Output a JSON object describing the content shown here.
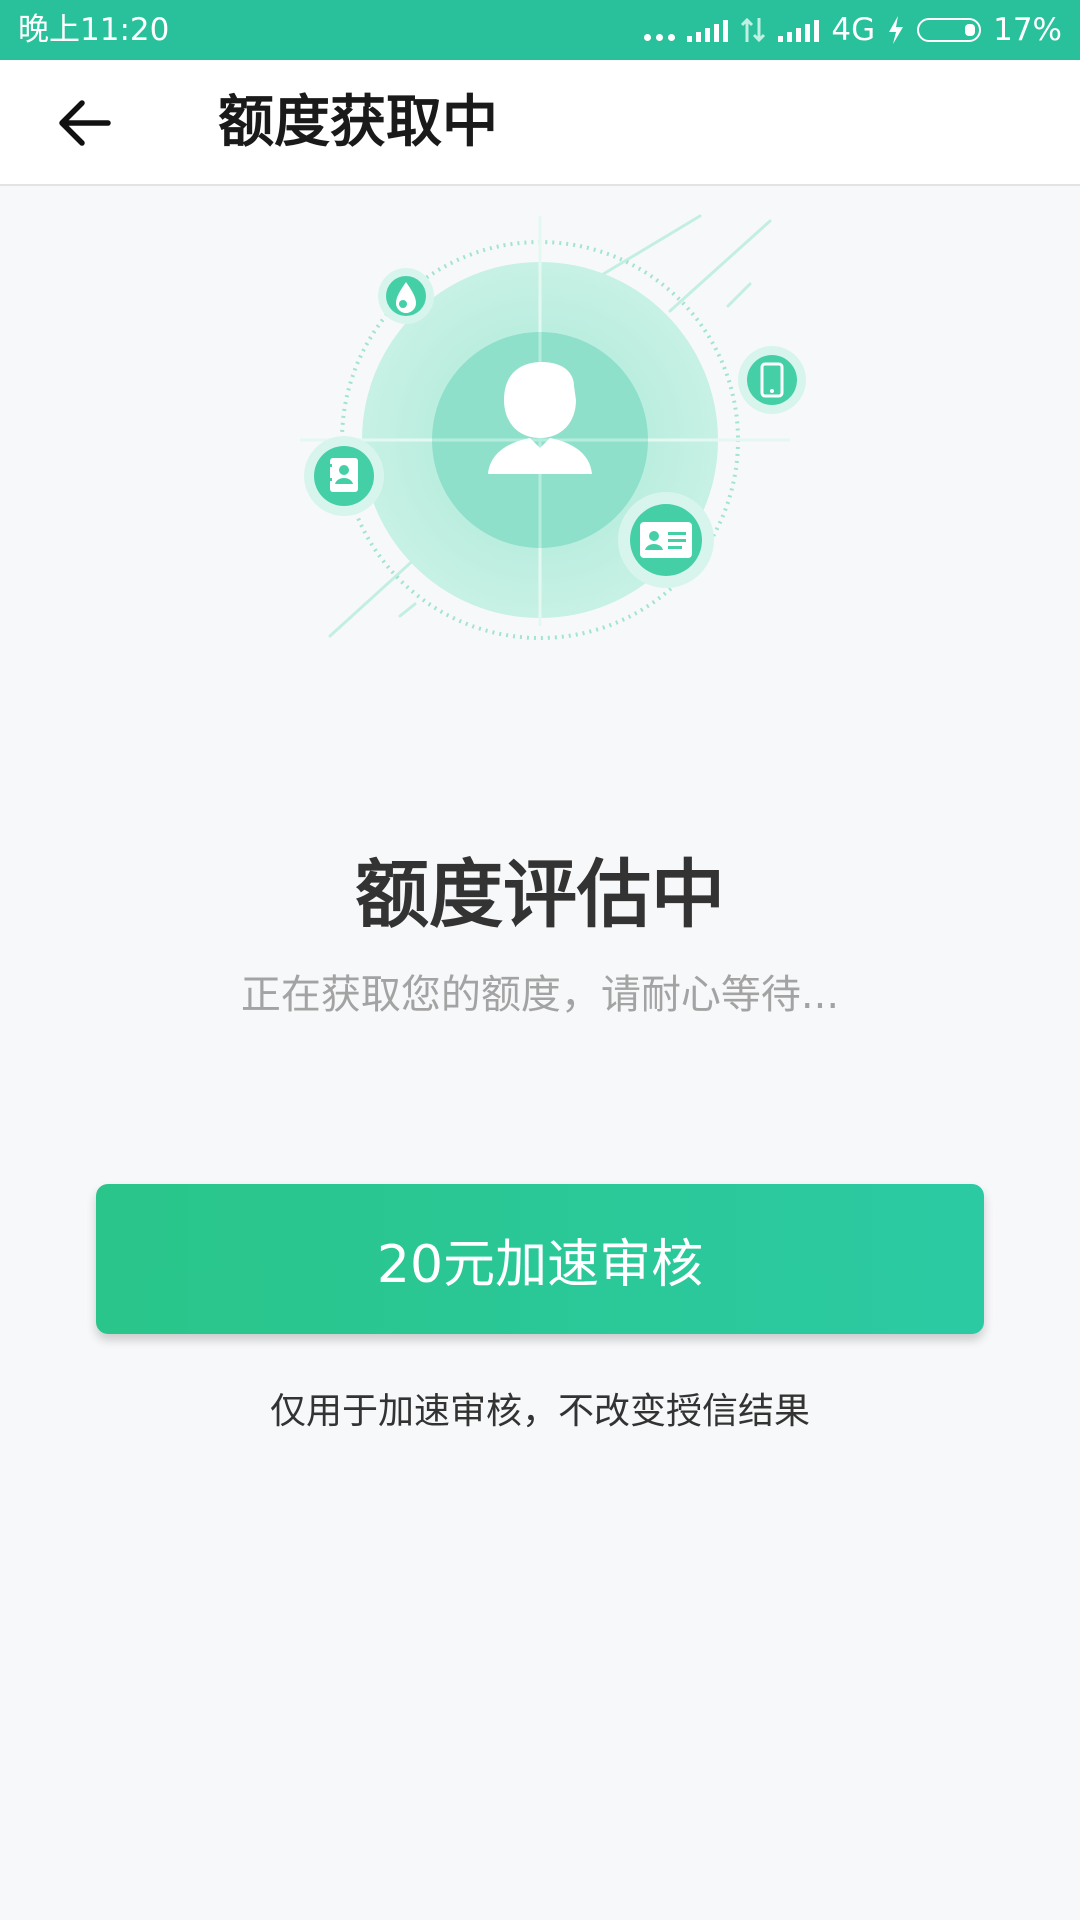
{
  "status_bar": {
    "time": "晚上11:20",
    "network": "4G",
    "battery": "17%",
    "battery_level_fraction": 0.17
  },
  "header": {
    "back_icon": "arrow-left-icon",
    "title": "额度获取中"
  },
  "illustration": {
    "center_icon": "user-silhouette-icon",
    "orbit_icons": [
      "water-drop-icon",
      "phone-icon",
      "contacts-book-icon",
      "id-card-icon"
    ],
    "colors": {
      "primary": "#29c19b",
      "light": "#b3ecdc",
      "mid": "#8fe0cb"
    }
  },
  "main": {
    "title": "额度评估中",
    "subtitle": "正在获取您的额度，请耐心等待...",
    "accelerate_button": "20元加速审核",
    "note": "仅用于加速审核，不改变授信结果"
  },
  "colors": {
    "accent": "#29c19b",
    "background": "#f7f8fa"
  }
}
